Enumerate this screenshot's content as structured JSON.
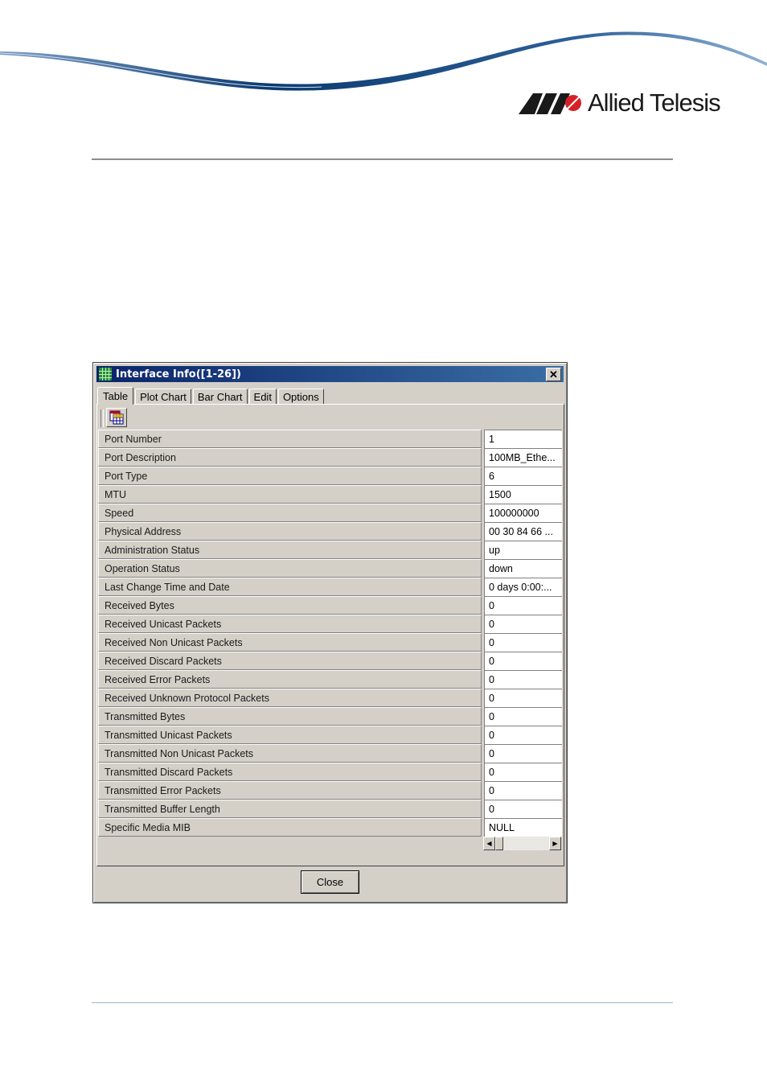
{
  "brand": {
    "name": "Allied Telesis",
    "logo_icon": "allied-telesis-logo-icon"
  },
  "dialog": {
    "title": "Interface Info([1-26])",
    "title_icon": "grid-icon",
    "close_glyph": "✕",
    "tabs": [
      {
        "label": "Table",
        "active": true
      },
      {
        "label": "Plot Chart"
      },
      {
        "label": "Bar Chart"
      },
      {
        "label": "Edit"
      },
      {
        "label": "Options"
      }
    ],
    "toolbar": {
      "table_tool_icon": "table-view-icon"
    },
    "rows": [
      {
        "label": "Port Number",
        "value": "1"
      },
      {
        "label": "Port Description",
        "value": "100MB_Ethe..."
      },
      {
        "label": "Port Type",
        "value": "6"
      },
      {
        "label": "MTU",
        "value": "1500"
      },
      {
        "label": "Speed",
        "value": "100000000"
      },
      {
        "label": "Physical Address",
        "value": "00 30 84 66 ..."
      },
      {
        "label": "Administration Status",
        "value": "up"
      },
      {
        "label": "Operation Status",
        "value": "down"
      },
      {
        "label": "Last Change Time and Date",
        "value": "0 days 0:00:..."
      },
      {
        "label": "Received Bytes",
        "value": "0"
      },
      {
        "label": "Received Unicast Packets",
        "value": "0"
      },
      {
        "label": "Received Non Unicast Packets",
        "value": "0"
      },
      {
        "label": "Received Discard Packets",
        "value": "0"
      },
      {
        "label": "Received Error Packets",
        "value": "0"
      },
      {
        "label": "Received Unknown Protocol Packets",
        "value": "0"
      },
      {
        "label": "Transmitted Bytes",
        "value": "0"
      },
      {
        "label": "Transmitted Unicast Packets",
        "value": "0"
      },
      {
        "label": "Transmitted Non Unicast Packets",
        "value": "0"
      },
      {
        "label": "Transmitted Discard Packets",
        "value": "0"
      },
      {
        "label": "Transmitted Error Packets",
        "value": "0"
      },
      {
        "label": "Transmitted Buffer Length",
        "value": "0"
      },
      {
        "label": "Specific Media MIB",
        "value": "NULL"
      }
    ],
    "close_button_label": "Close"
  },
  "colors": {
    "title_bar_start": "#0a246a",
    "title_bar_end": "#3a6ea5",
    "dialog_face": "#d4d0c8",
    "swoosh_dark": "#0b3a70",
    "swoosh_light": "#6f95bf",
    "logo_red": "#d62027"
  }
}
